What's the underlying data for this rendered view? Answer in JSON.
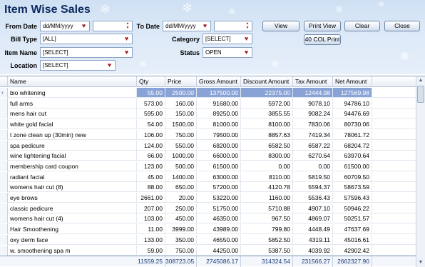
{
  "title": "Item Wise Sales",
  "filters": {
    "from_date_label": "From Date",
    "from_date_value": "dd/MM/yyyy",
    "to_date_label": "To Date",
    "to_date_value": "dd/MM/yyyy",
    "bill_type_label": "Bill Type",
    "bill_type_value": "[ALL]",
    "category_label": "Category",
    "category_value": "[SELECT]",
    "item_name_label": "Item Name",
    "item_name_value": "[SELECT]",
    "status_label": "Status",
    "status_value": "OPEN",
    "location_label": "Location",
    "location_value": "[SELECT]"
  },
  "buttons": {
    "view": "View",
    "print_view": "Print View",
    "clear": "Clear",
    "close": "Close",
    "col_print": "40 COL Print"
  },
  "columns": [
    "Name",
    "Qty",
    "Price",
    "Gross Amount",
    "Discount Amount",
    "Tax Amount",
    "Net Amount"
  ],
  "rows": [
    [
      "bio whitening",
      "55.00",
      "2500.00",
      "137500.00",
      "22375.00",
      "12444.98",
      "127569.98"
    ],
    [
      "full arms",
      "573.00",
      "160.00",
      "91680.00",
      "5972.00",
      "9078.10",
      "94786.10"
    ],
    [
      "mens hair cut",
      "595.00",
      "150.00",
      "89250.00",
      "3855.55",
      "9082.24",
      "94476.69"
    ],
    [
      "white gold facial",
      "54.00",
      "1500.00",
      "81000.00",
      "8100.00",
      "7830.06",
      "80730.06"
    ],
    [
      "t zone clean up (30min) new",
      "106.00",
      "750.00",
      "79500.00",
      "8857.63",
      "7419.34",
      "78061.72"
    ],
    [
      "spa pedicure",
      "124.00",
      "550.00",
      "68200.00",
      "6582.50",
      "6587.22",
      "68204.72"
    ],
    [
      "wine lightening facial",
      "66.00",
      "1000.00",
      "66000.00",
      "8300.00",
      "6270.64",
      "63970.64"
    ],
    [
      "membership card coupon",
      "123.00",
      "500.00",
      "61500.00",
      "0.00",
      "0.00",
      "61500.00"
    ],
    [
      "radiant facial",
      "45.00",
      "1400.00",
      "63000.00",
      "8110.00",
      "5819.50",
      "60709.50"
    ],
    [
      "womens hair cut (8)",
      "88.00",
      "650.00",
      "57200.00",
      "4120.78",
      "5594.37",
      "58673.59"
    ],
    [
      "eye brows",
      "2661.00",
      "20.00",
      "53220.00",
      "1160.00",
      "5536.43",
      "57596.43"
    ],
    [
      "classic pedicure",
      "207.00",
      "250.00",
      "51750.00",
      "5710.88",
      "4907.10",
      "50946.22"
    ],
    [
      "womens hair cut (4)",
      "103.00",
      "450.00",
      "46350.00",
      "967.50",
      "4869.07",
      "50251.57"
    ],
    [
      "Hair Smoothening",
      "11.00",
      "3999.00",
      "43989.00",
      "799.80",
      "4448.49",
      "47637.69"
    ],
    [
      "oxy derm face",
      "133.00",
      "350.00",
      "46550.00",
      "5852.50",
      "4319.11",
      "45016.61"
    ],
    [
      "w. smoothening spa m",
      "59.00",
      "750.00",
      "44250.00",
      "5387.50",
      "4039.92",
      "42902.42"
    ]
  ],
  "totals": [
    "11559.25",
    "308723.05",
    "2745086.17",
    "314324.54",
    "231566.27",
    "2662327.90"
  ],
  "icons": {
    "dropdown": "heart-dropdown-icon",
    "spinner": "updown-spinner-icon",
    "row_pointer": "row-pointer-icon"
  },
  "colors": {
    "header_bg": "#d6e4f5",
    "title": "#0d2b5e",
    "selection": "#8aa3d6",
    "dropdown_glyph": "#a0242c"
  }
}
